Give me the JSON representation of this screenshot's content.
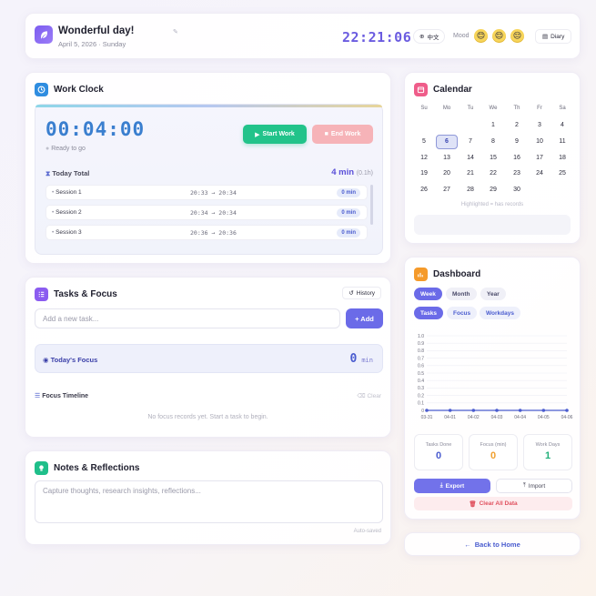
{
  "header": {
    "greeting": "Wonderful day!",
    "date": "April 5, 2026 · Sunday",
    "clock": "22:21:06",
    "language": "中文",
    "mood_label": "Mood",
    "moods": [
      "😊",
      "😌",
      "😔"
    ],
    "diary_label": "Diary"
  },
  "work_clock": {
    "title": "Work Clock",
    "timer": "00:04:00",
    "status": "Ready to go",
    "start_label": "Start Work",
    "end_label": "End Work",
    "today_label": "Today Total",
    "today_value": "4 min",
    "today_hours": "(0.1h)",
    "sessions": [
      {
        "name": "Session 1",
        "time": "20:33 → 20:34",
        "duration": "0 min"
      },
      {
        "name": "Session 2",
        "time": "20:34 → 20:34",
        "duration": "0 min"
      },
      {
        "name": "Session 3",
        "time": "20:36 → 20:36",
        "duration": "0 min"
      }
    ]
  },
  "tasks": {
    "title": "Tasks & Focus",
    "history_label": "History",
    "input_placeholder": "Add a new task...",
    "add_label": "+ Add",
    "focus_label": "Today's Focus",
    "focus_value": "0",
    "focus_unit": "min",
    "timeline_label": "Focus Timeline",
    "clear_label": "Clear",
    "empty_text": "No focus records yet. Start a task to begin."
  },
  "notes": {
    "title": "Notes & Reflections",
    "placeholder": "Capture thoughts, research insights, reflections...",
    "autosaved": "Auto-saved"
  },
  "calendar": {
    "title": "Calendar",
    "weekdays": [
      "Su",
      "Mo",
      "Tu",
      "We",
      "Th",
      "Fr",
      "Sa"
    ],
    "weeks": [
      [
        "",
        "",
        "",
        "1",
        "2",
        "3",
        "4"
      ],
      [
        "5",
        "6",
        "7",
        "8",
        "9",
        "10",
        "11"
      ],
      [
        "12",
        "13",
        "14",
        "15",
        "16",
        "17",
        "18"
      ],
      [
        "19",
        "20",
        "21",
        "22",
        "23",
        "24",
        "25"
      ],
      [
        "26",
        "27",
        "28",
        "29",
        "30",
        "",
        ""
      ]
    ],
    "selected": "6",
    "hint": "Highlighted = has records"
  },
  "dashboard": {
    "title": "Dashboard",
    "ranges": [
      "Week",
      "Month",
      "Year"
    ],
    "active_range": "Week",
    "metrics": [
      "Tasks",
      "Focus",
      "Workdays"
    ],
    "active_metric": "Tasks",
    "stats": [
      {
        "label": "Tasks Done",
        "value": "0",
        "color": "#4a5ccf"
      },
      {
        "label": "Focus (min)",
        "value": "0",
        "color": "#f0a030"
      },
      {
        "label": "Work Days",
        "value": "1",
        "color": "#22b07a"
      }
    ],
    "export_label": "Export",
    "import_label": "Import",
    "clear_label": "Clear All Data"
  },
  "chart_data": {
    "type": "line",
    "x": [
      "03-31",
      "04-01",
      "04-02",
      "04-03",
      "04-04",
      "04-05",
      "04-06"
    ],
    "series": [
      {
        "values": [
          0,
          0,
          0,
          0,
          0,
          0,
          0
        ]
      }
    ],
    "ylim": [
      0,
      1.0
    ],
    "yticks": [
      "0",
      "0.1",
      "0.2",
      "0.3",
      "0.4",
      "0.5",
      "0.6",
      "0.7",
      "0.8",
      "0.9",
      "1.0"
    ],
    "color": "#4a5ccf",
    "grid": true
  },
  "back_label": "Back to Home"
}
